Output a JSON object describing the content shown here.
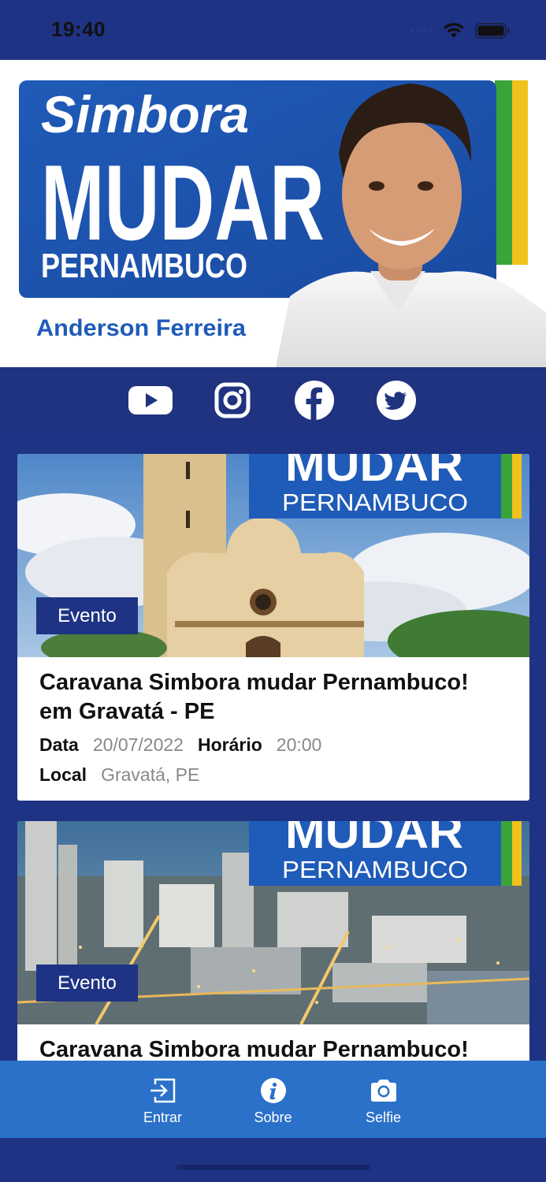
{
  "status_bar": {
    "time": "19:40"
  },
  "banner": {
    "line1": "Simbora",
    "line2": "MUDAR",
    "line3": "PERNAMBUCO",
    "candidate": "Anderson Ferreira"
  },
  "social": {
    "icons": [
      "youtube-icon",
      "instagram-icon",
      "facebook-icon",
      "twitter-icon"
    ]
  },
  "events": [
    {
      "badge": "Evento",
      "image_text_top": "MUDAR",
      "image_text_bottom": "PERNAMBUCO",
      "title": "Caravana Simbora mudar Pernambuco! em Gravatá - PE",
      "date_label": "Data",
      "date": "20/07/2022",
      "time_label": "Horário",
      "time": "20:00",
      "place_label": "Local",
      "place": "Gravatá, PE"
    },
    {
      "badge": "Evento",
      "image_text_top": "MUDAR",
      "image_text_bottom": "PERNAMBUCO",
      "title": "Caravana Simbora mudar Pernambuco!"
    }
  ],
  "nav": {
    "items": [
      {
        "label": "Entrar",
        "icon": "login-icon"
      },
      {
        "label": "Sobre",
        "icon": "info-icon"
      },
      {
        "label": "Selfie",
        "icon": "camera-icon"
      }
    ]
  },
  "colors": {
    "background": "#1e3384",
    "nav": "#2b71c9",
    "badge": "#1f3384",
    "banner_blue": "#1f5bb8",
    "stripe_green": "#3aa33a",
    "stripe_yellow": "#f1c21b"
  }
}
